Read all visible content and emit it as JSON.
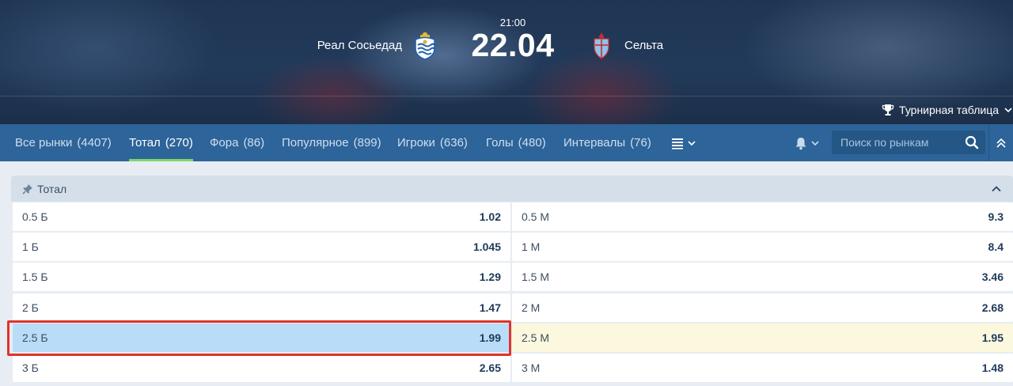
{
  "match": {
    "time": "21:00",
    "date": "22.04",
    "home_team": "Реал Сосьедад",
    "away_team": "Сельта",
    "home_crest_icon": "real-sociedad-crest-icon",
    "away_crest_icon": "celta-crest-icon"
  },
  "standings_link": {
    "label": "Турнирная таблица",
    "icon": "trophy-icon"
  },
  "tabs": [
    {
      "label": "Все рынки",
      "count": "(4407)",
      "active": false
    },
    {
      "label": "Тотал",
      "count": "(270)",
      "active": true
    },
    {
      "label": "Фора",
      "count": "(86)",
      "active": false
    },
    {
      "label": "Популярное",
      "count": "(899)",
      "active": false
    },
    {
      "label": "Игроки",
      "count": "(636)",
      "active": false
    },
    {
      "label": "Голы",
      "count": "(480)",
      "active": false
    },
    {
      "label": "Интервалы",
      "count": "(76)",
      "active": false
    }
  ],
  "search": {
    "placeholder": "Поиск по рынкам",
    "value": ""
  },
  "market": {
    "title": "Тотал",
    "rows": [
      {
        "over_label": "0.5 Б",
        "over_odds": "1.02",
        "under_label": "0.5 М",
        "under_odds": "9.3"
      },
      {
        "over_label": "1 Б",
        "over_odds": "1.045",
        "under_label": "1 М",
        "under_odds": "8.4"
      },
      {
        "over_label": "1.5 Б",
        "over_odds": "1.29",
        "under_label": "1.5 М",
        "under_odds": "3.46"
      },
      {
        "over_label": "2 Б",
        "over_odds": "1.47",
        "under_label": "2 М",
        "under_odds": "2.68"
      },
      {
        "over_label": "2.5 Б",
        "over_odds": "1.99",
        "under_label": "2.5 М",
        "under_odds": "1.95"
      },
      {
        "over_label": "3 Б",
        "over_odds": "2.65",
        "under_label": "3 М",
        "under_odds": "1.48"
      }
    ],
    "selected_over_row": 4,
    "hover_under_row": 4
  },
  "colors": {
    "tab_bar": "#2d6499",
    "active_tab_underline": "#7ed76c",
    "selected_cell": "#b9dcf8",
    "hover_cell": "#fbf8de",
    "highlight_border": "#e0342a"
  }
}
